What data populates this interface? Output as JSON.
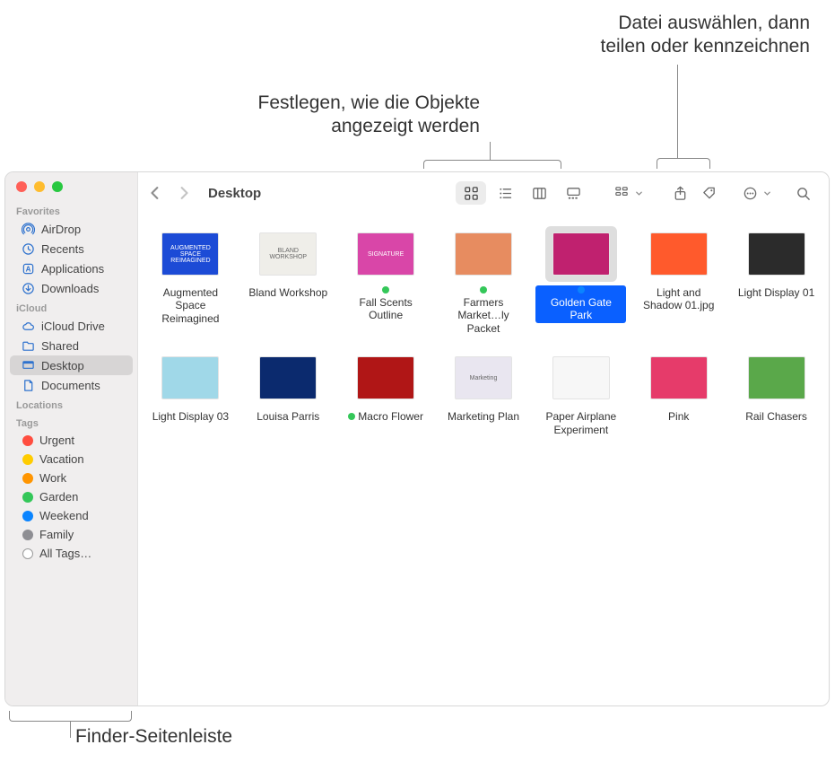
{
  "callouts": {
    "top_right": "Datei auswählen, dann\nteilen oder kennzeichnen",
    "top_left": "Festlegen, wie die Objekte\nangezeigt werden",
    "bottom": "Finder-Seitenleiste"
  },
  "window": {
    "title": "Desktop"
  },
  "sidebar": {
    "sections": [
      {
        "header": "Favorites",
        "items": [
          {
            "label": "AirDrop",
            "icon": "airdrop"
          },
          {
            "label": "Recents",
            "icon": "clock"
          },
          {
            "label": "Applications",
            "icon": "app"
          },
          {
            "label": "Downloads",
            "icon": "download"
          }
        ]
      },
      {
        "header": "iCloud",
        "items": [
          {
            "label": "iCloud Drive",
            "icon": "cloud"
          },
          {
            "label": "Shared",
            "icon": "folder"
          },
          {
            "label": "Desktop",
            "icon": "desktop",
            "active": true
          },
          {
            "label": "Documents",
            "icon": "doc"
          }
        ]
      },
      {
        "header": "Locations",
        "items": []
      },
      {
        "header": "Tags",
        "items": [
          {
            "label": "Urgent",
            "tagColor": "#ff4d3f"
          },
          {
            "label": "Vacation",
            "tagColor": "#ffcc00"
          },
          {
            "label": "Work",
            "tagColor": "#ff9500"
          },
          {
            "label": "Garden",
            "tagColor": "#34c759"
          },
          {
            "label": "Weekend",
            "tagColor": "#0a84ff"
          },
          {
            "label": "Family",
            "tagColor": "#8e8e93"
          },
          {
            "label": "All Tags…",
            "tagOutline": true
          }
        ]
      }
    ]
  },
  "files": [
    {
      "label": "Augmented Space Reimagined",
      "thumbColor": "#1c4bd6",
      "text": "AUGMENTED SPACE REIMAGINED"
    },
    {
      "label": "Bland Workshop",
      "thumbColor": "#efeee9",
      "text": "BLAND WORKSHOP",
      "textColor": "#666"
    },
    {
      "label": "Fall Scents Outline",
      "thumbColor": "#d946a8",
      "tagColor": "#34c759",
      "text": "SIGNATURE"
    },
    {
      "label": "Farmers Market…ly Packet",
      "thumbColor": "#e78c60",
      "tagColor": "#34c759",
      "text": ""
    },
    {
      "label": "Golden Gate Park",
      "thumbColor": "#c0216f",
      "tagColor": "#0a84ff",
      "selected": true,
      "text": ""
    },
    {
      "label": "Light and Shadow 01.jpg",
      "thumbColor": "#ff5a2c",
      "text": ""
    },
    {
      "label": "Light Display 01",
      "thumbColor": "#2b2b2b",
      "text": ""
    },
    {
      "label": "Light Display 03",
      "thumbColor": "#a0d8e8",
      "text": ""
    },
    {
      "label": "Louisa Parris",
      "thumbColor": "#0b2a6e",
      "text": ""
    },
    {
      "label": "Macro Flower",
      "thumbColor": "#b01616",
      "tagColor": "#34c759",
      "text": ""
    },
    {
      "label": "Marketing Plan",
      "thumbColor": "#e9e6f0",
      "text": "Marketing",
      "textColor": "#666"
    },
    {
      "label": "Paper Airplane Experiment",
      "thumbColor": "#f7f7f7",
      "text": "",
      "textColor": "#666"
    },
    {
      "label": "Pink",
      "thumbColor": "#e63b6a",
      "text": ""
    },
    {
      "label": "Rail Chasers",
      "thumbColor": "#5aa84a",
      "text": ""
    }
  ]
}
